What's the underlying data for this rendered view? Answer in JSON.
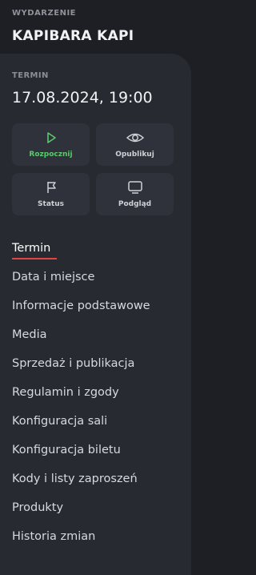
{
  "event": {
    "kicker": "WYDARZENIE",
    "name": "KAPIBARA KAPI"
  },
  "term": {
    "kicker": "TERMIN",
    "value": "17.08.2024, 19:00"
  },
  "actions": [
    {
      "label": "Rozpocznij",
      "icon": "play-icon",
      "accent": "#5bc96b"
    },
    {
      "label": "Opublikuj",
      "icon": "eye-icon"
    },
    {
      "label": "Status",
      "icon": "flag-icon"
    },
    {
      "label": "Podgląd",
      "icon": "monitor-icon"
    }
  ],
  "nav": {
    "active_index": 0,
    "active_underline_color": "#e0463f",
    "items": [
      "Termin",
      "Data i miejsce",
      "Informacje podstawowe",
      "Media",
      "Sprzedaż i publikacja",
      "Regulamin i zgody",
      "Konfiguracja sali",
      "Konfiguracja biletu",
      "Kody i listy zaproszeń",
      "Produkty",
      "Historia zmian"
    ]
  }
}
